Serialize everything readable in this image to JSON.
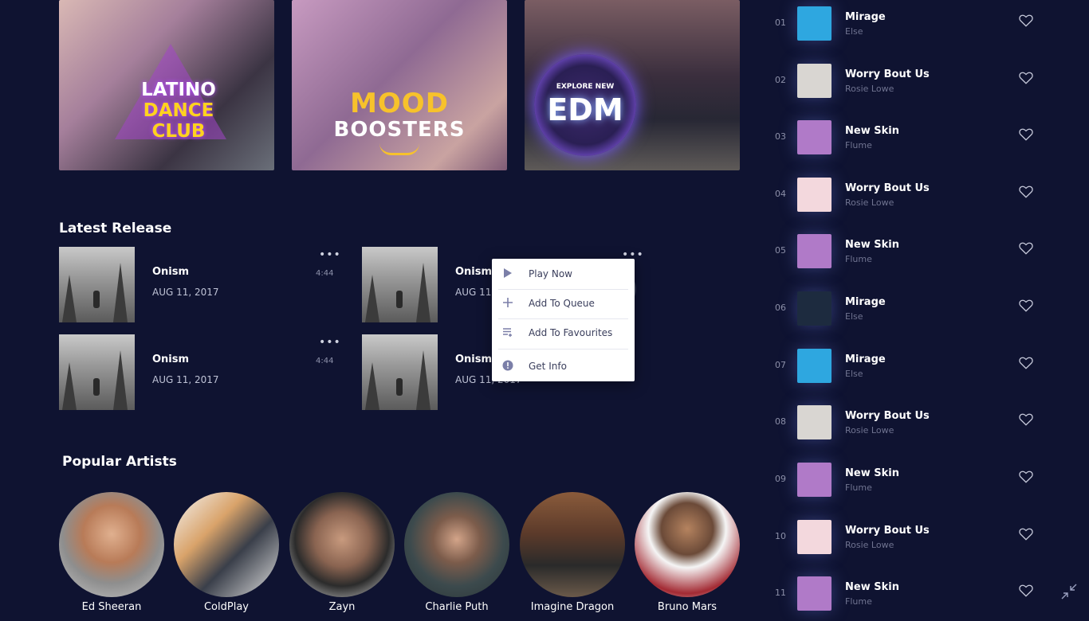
{
  "playlists": [
    {
      "line1": "LATINO",
      "line2": "DANCE",
      "line3": "CLUB"
    },
    {
      "line1": "MOOD",
      "line2": "BOOSTERS"
    },
    {
      "line1": "EXPLORE NEW",
      "line2": "EDM"
    }
  ],
  "latest_release": {
    "title": "Latest Release",
    "items": [
      {
        "title": "Onism",
        "date": "AUG 11, 2017",
        "duration": "4:44",
        "menu": "•••"
      },
      {
        "title": "Onism",
        "date": "AUG 11, 2017",
        "duration": "",
        "menu": "•••"
      },
      {
        "title": "Onism",
        "date": "AUG 11, 2017",
        "duration": "4:44",
        "menu": "•••"
      },
      {
        "title": "Onism",
        "date": "AUG 11, 2017",
        "duration": "",
        "menu": ""
      }
    ]
  },
  "context_menu": {
    "items": [
      {
        "label": "Play Now",
        "icon": "play-icon"
      },
      {
        "label": "Add To Queue",
        "icon": "plus-icon"
      },
      {
        "label": "Add To Favourites",
        "icon": "playlist-add-icon"
      },
      {
        "label": "Get Info",
        "icon": "info-icon"
      }
    ]
  },
  "popular_artists": {
    "title": "Popular Artists",
    "artists": [
      "Ed Sheeran",
      "ColdPlay",
      "Zayn",
      "Charlie Puth",
      "Imagine Dragon",
      "Bruno Mars"
    ]
  },
  "tracks": [
    {
      "num": "01",
      "title": "Mirage",
      "artist": "Else",
      "art": "#2ea7e0"
    },
    {
      "num": "02",
      "title": "Worry Bout Us",
      "artist": "Rosie Lowe",
      "art": "#d9d6d2"
    },
    {
      "num": "03",
      "title": "New Skin",
      "artist": "Flume",
      "art": "#b07ac8"
    },
    {
      "num": "04",
      "title": "Worry Bout Us",
      "artist": "Rosie Lowe",
      "art": "#f3d8dd"
    },
    {
      "num": "05",
      "title": "New Skin",
      "artist": "Flume",
      "art": "#b07ac8"
    },
    {
      "num": "06",
      "title": "Mirage",
      "artist": "Else",
      "art": "#1d2b3f"
    },
    {
      "num": "07",
      "title": "Mirage",
      "artist": "Else",
      "art": "#2ea7e0"
    },
    {
      "num": "08",
      "title": "Worry Bout Us",
      "artist": "Rosie Lowe",
      "art": "#d9d6d2"
    },
    {
      "num": "09",
      "title": "New Skin",
      "artist": "Flume",
      "art": "#b07ac8"
    },
    {
      "num": "10",
      "title": "Worry Bout Us",
      "artist": "Rosie Lowe",
      "art": "#f3d8dd"
    },
    {
      "num": "11",
      "title": "New Skin",
      "artist": "Flume",
      "art": "#b07ac8"
    }
  ]
}
